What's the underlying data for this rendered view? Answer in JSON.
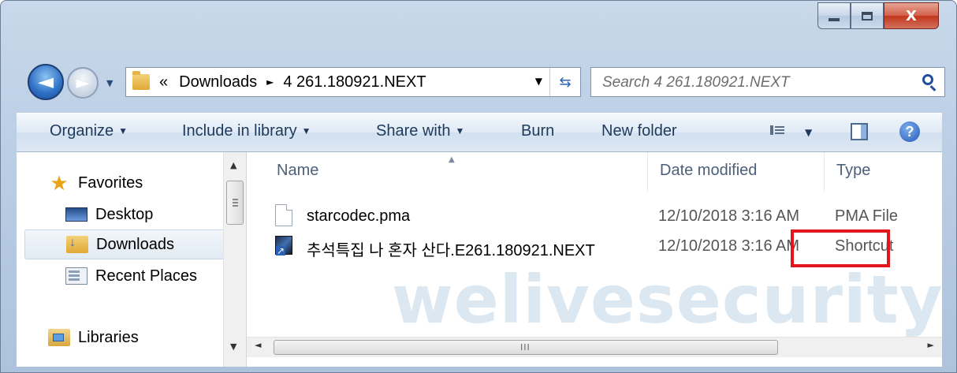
{
  "window": {
    "caption_minimize": "minimize",
    "caption_maximize": "maximize",
    "caption_close": "X"
  },
  "navigation": {
    "back_glyph": "◄",
    "forward_glyph": "►",
    "address_prefix": "«",
    "address_parts": [
      "Downloads",
      "4 261.180921.NEXT"
    ],
    "address_separator": "►",
    "dropdown_glyph": "▼",
    "refresh_glyph": "⇆",
    "search_placeholder": "Search 4 261.180921.NEXT"
  },
  "toolbar": {
    "organize": "Organize",
    "include_in_library": "Include in library",
    "share_with": "Share with",
    "burn": "Burn",
    "new_folder": "New folder",
    "help": "?"
  },
  "sidebar": {
    "items": [
      {
        "label": "Favorites",
        "icon": "star-icon"
      },
      {
        "label": "Desktop",
        "icon": "desktop-icon"
      },
      {
        "label": "Downloads",
        "icon": "downloads-icon",
        "selected": true
      },
      {
        "label": "Recent Places",
        "icon": "recent-places-icon"
      },
      {
        "label": "Libraries",
        "icon": "libraries-icon"
      }
    ]
  },
  "files": {
    "columns": [
      "Name",
      "Date modified",
      "Type"
    ],
    "rows": [
      {
        "name": "starcodec.pma",
        "date": "12/10/2018 3:16 AM",
        "type": "PMA File",
        "icon": "file-icon"
      },
      {
        "name": "추석특집 나 혼자 산다.E261.180921.NEXT",
        "date": "12/10/2018 3:16 AM",
        "type": "Shortcut",
        "icon": "shortcut-icon"
      }
    ]
  },
  "watermark": "welivesecurity",
  "scrollbar": {
    "grip": "III"
  },
  "colors": {
    "highlight": "#e3171b",
    "accent": "#2a62b5"
  }
}
